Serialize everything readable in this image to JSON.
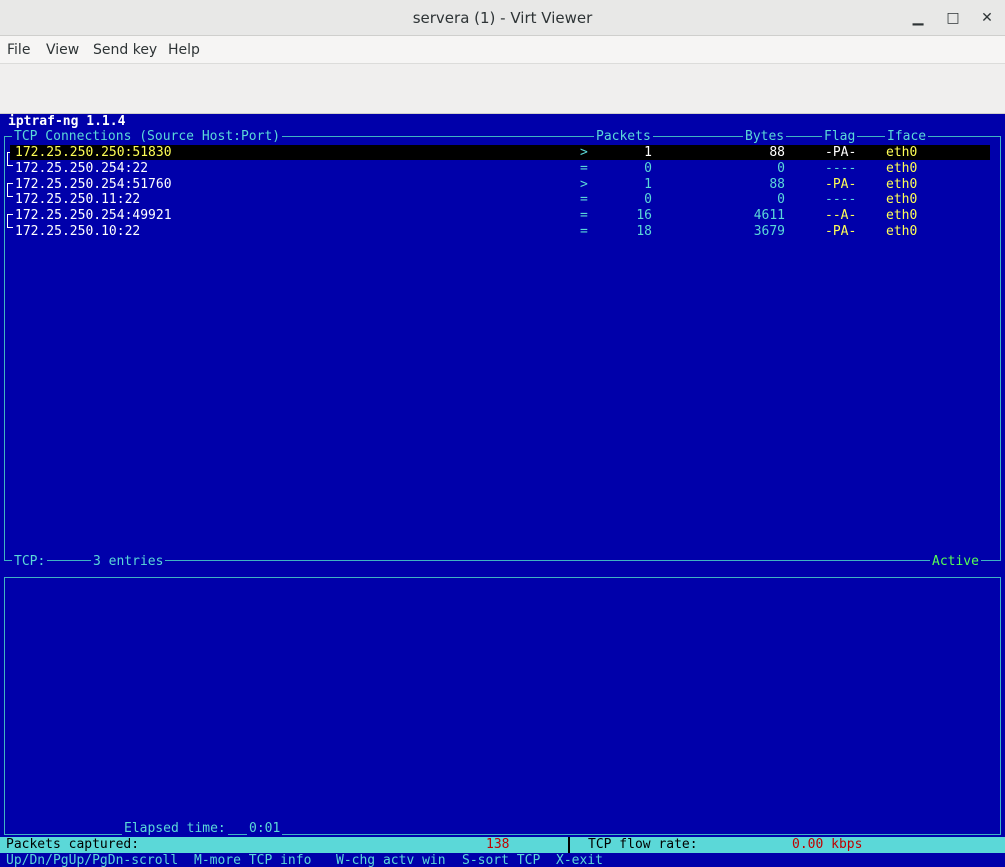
{
  "window": {
    "title": "servera (1) - Virt Viewer",
    "minimize_glyph": "▁",
    "maximize_glyph": "□",
    "close_glyph": "✕"
  },
  "menu": {
    "items": [
      "File",
      "View",
      "Send key",
      "Help"
    ]
  },
  "terminal": {
    "app_name": "iptraf-ng 1.1.4",
    "header": {
      "connections": "TCP Connections (Source Host:Port)",
      "packets": "Packets",
      "bytes": "Bytes",
      "flag": "Flag",
      "iface": "Iface"
    },
    "rows": [
      {
        "host": "172.25.250.250:51830",
        "dir": ">",
        "packets": "1",
        "bytes": "88",
        "flag": "-PA-",
        "iface": "eth0"
      },
      {
        "host": "172.25.250.254:22",
        "dir": "=",
        "packets": "0",
        "bytes": "0",
        "flag": "----",
        "iface": "eth0"
      },
      {
        "host": "172.25.250.254:51760",
        "dir": ">",
        "packets": "1",
        "bytes": "88",
        "flag": "-PA-",
        "iface": "eth0"
      },
      {
        "host": "172.25.250.11:22",
        "dir": "=",
        "packets": "0",
        "bytes": "0",
        "flag": "----",
        "iface": "eth0"
      },
      {
        "host": "172.25.250.254:49921",
        "dir": "=",
        "packets": "16",
        "bytes": "4611",
        "flag": "--A-",
        "iface": "eth0"
      },
      {
        "host": "172.25.250.10:22",
        "dir": "=",
        "packets": "18",
        "bytes": "3679",
        "flag": "-PA-",
        "iface": "eth0"
      }
    ],
    "tcp_label": "TCP:",
    "tcp_entries": "3 entries",
    "active_label": "Active",
    "elapsed_label": "Elapsed time:",
    "elapsed_value": "0:01",
    "packets_captured_label": "Packets captured:",
    "packets_captured_value": "138",
    "flow_rate_label": "TCP flow rate:",
    "flow_rate_value": "0.00 kbps",
    "help": {
      "scroll": "Up/Dn/PgUp/PgDn-scroll",
      "more": "M-more TCP info",
      "chg": "W-chg actv win",
      "sort": "S-sort TCP",
      "exit": "X-exit"
    }
  }
}
